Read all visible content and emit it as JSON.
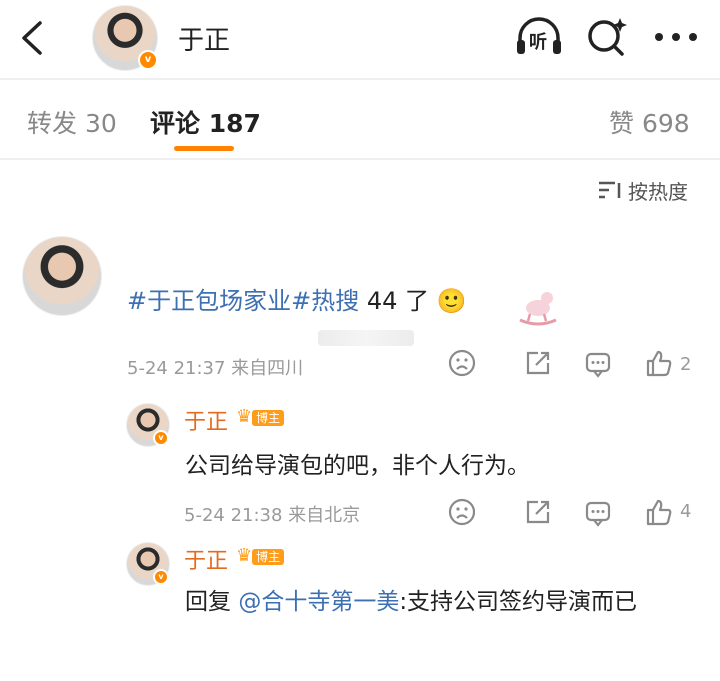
{
  "header": {
    "back_icon": "chevron-left-icon",
    "username": "于正",
    "listen_label": "听",
    "search_icon": "search-sparkle-icon",
    "more_icon": "more-dots-icon"
  },
  "tabs": {
    "repost": "转发 30",
    "comments": "评论 187",
    "likes": "赞 698",
    "accent": "#ff8200"
  },
  "sort": {
    "label": "按热度",
    "icon": "sort-lines-icon"
  },
  "comments": [
    {
      "text_topic": "#于正包场家业#热搜",
      "text_rest": " 44 了",
      "emoji": "🙂",
      "meta": "5-24 21:37 来自四川",
      "likes": "2",
      "replies": [
        {
          "username": "于正",
          "badge": "博主",
          "text": "公司给导演包的吧，非个人行为。",
          "meta": "5-24 21:38 来自北京",
          "likes": "4"
        },
        {
          "username": "于正",
          "badge": "博主",
          "reply_prefix": "回复 ",
          "mention": "@合十寺第一美",
          "text": ":支持公司签约导演而已"
        }
      ]
    }
  ]
}
